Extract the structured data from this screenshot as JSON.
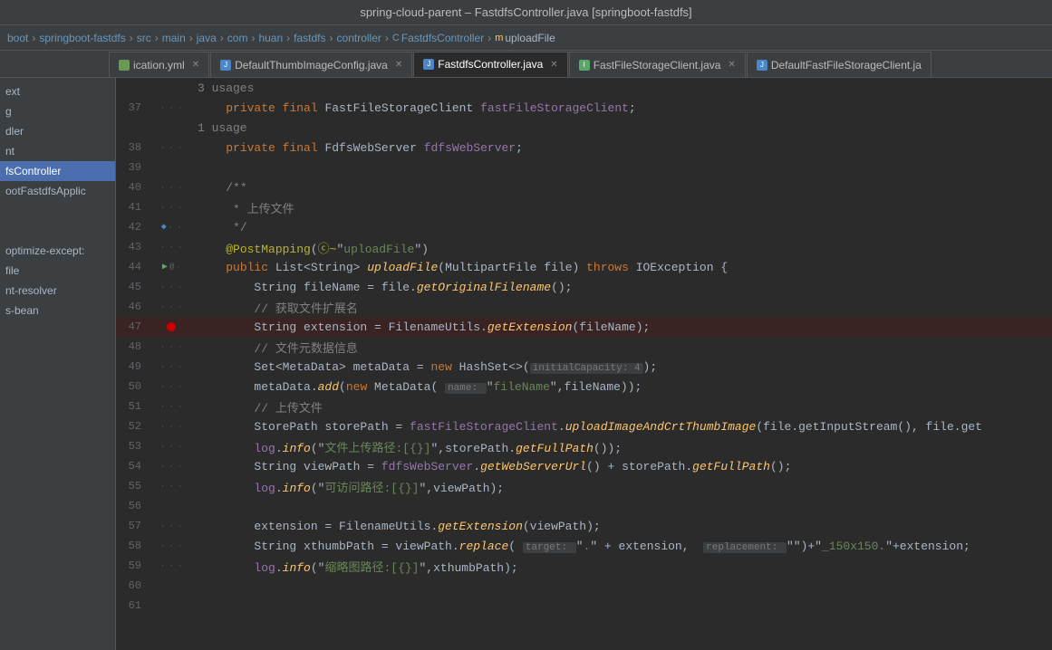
{
  "titleBar": {
    "title": "spring-cloud-parent – FastdfsController.java [springboot-fastdfs]"
  },
  "breadcrumb": {
    "items": [
      "boot",
      "springboot-fastdfs",
      "src",
      "main",
      "java",
      "com",
      "huan",
      "fastdfs",
      "controller"
    ],
    "className": "FastdfsController",
    "methodName": "uploadFile"
  },
  "tabs": [
    {
      "name": "ication.yml",
      "type": "yml",
      "active": false,
      "modified": false
    },
    {
      "name": "DefaultThumbImageConfig.java",
      "type": "java",
      "active": false,
      "modified": false
    },
    {
      "name": "FastdfsController.java",
      "type": "java",
      "active": true,
      "modified": false
    },
    {
      "name": "FastFileStorageClient.java",
      "type": "interface",
      "active": false,
      "modified": false
    },
    {
      "name": "DefaultFastFileStorageClient.ja",
      "type": "java",
      "active": false,
      "modified": false
    }
  ],
  "sidebar": {
    "items": [
      {
        "label": "ext",
        "selected": false
      },
      {
        "label": "g",
        "selected": false
      },
      {
        "label": "dler",
        "selected": false
      },
      {
        "label": "nt",
        "selected": false
      },
      {
        "label": "fsController",
        "selected": true
      },
      {
        "label": "ootFastdfsApplic",
        "selected": false
      },
      {
        "label": "",
        "selected": false
      },
      {
        "label": "",
        "selected": false
      },
      {
        "label": "optimize-except:",
        "selected": false
      },
      {
        "label": "file",
        "selected": false
      },
      {
        "label": "nt-resolver",
        "selected": false
      },
      {
        "label": "s-bean",
        "selected": false
      }
    ]
  },
  "codeLines": [
    {
      "num": 37,
      "usageHint": "3 usages",
      "gutter": "",
      "content": "    <kw>private</kw> <kw>final</kw> FastFileStorageClient <field>fastFileStorageClient</field>;",
      "highlighted": false
    },
    {
      "num": 38,
      "usageHint": "1 usage",
      "gutter": "",
      "content": "    <kw>private</kw> <kw>final</kw> FdfsWebServer <field>fdfsWebServer</field>;",
      "highlighted": false
    },
    {
      "num": 39,
      "gutter": "",
      "content": "",
      "highlighted": false
    },
    {
      "num": 40,
      "gutter": "",
      "content": "    <comment>/**</comment>",
      "highlighted": false
    },
    {
      "num": 41,
      "gutter": "",
      "content": "     <comment>* 上传文件</comment>",
      "highlighted": false
    },
    {
      "num": 42,
      "gutter": "",
      "content": "     <comment>*/</comment>",
      "highlighted": false
    },
    {
      "num": 43,
      "gutter": "",
      "content": "    <annotation>@PostMapping</annotation>(<annotation>@</annotation>\"<str>uploadFile</str>\")",
      "highlighted": false
    },
    {
      "num": 44,
      "gutter": "run annotation",
      "content": "    <kw>public</kw> List<String> <cn>uploadFile</cn>(MultipartFile file) <kw>throws</kw> IOException {",
      "highlighted": false
    },
    {
      "num": 45,
      "gutter": "",
      "content": "        String fileName = file.<cn>getOriginalFilename</cn>();",
      "highlighted": false
    },
    {
      "num": 46,
      "gutter": "",
      "content": "        <comment>// 获取文件扩展名</comment>",
      "highlighted": false
    },
    {
      "num": 47,
      "gutter": "breakpoint",
      "content": "        String extension = FilenameUtils.<cn>getExtension</cn>(fileName);",
      "highlighted": true
    },
    {
      "num": 48,
      "gutter": "",
      "content": "        <comment>// 文件元数据信息</comment>",
      "highlighted": false
    },
    {
      "num": 49,
      "gutter": "",
      "content": "        Set<MetaData> metaData = <kw>new</kw> HashSet<>(<hint>initialCapacity: 4</hint>);",
      "highlighted": false
    },
    {
      "num": 50,
      "gutter": "",
      "content": "        metaData.<cn>add</cn>(<kw>new</kw> MetaData( <hint>name: </hint>\"<str>fileName</str>\",fileName));",
      "highlighted": false
    },
    {
      "num": 51,
      "gutter": "",
      "content": "        <comment>// 上传文件</comment>",
      "highlighted": false
    },
    {
      "num": 52,
      "gutter": "",
      "content": "        StorePath storePath = <field>fastFileStorageClient</field>.<cn>uploadImageAndCrtThumbImage</cn>(file.getInputStream(), file.get",
      "highlighted": false
    },
    {
      "num": 53,
      "gutter": "",
      "content": "        <field>log</field>.<cn>info</cn>(\"<str>文件上传路径:[{}]</str>\",storePath.<cn>getFullPath</cn>());",
      "highlighted": false
    },
    {
      "num": 54,
      "gutter": "",
      "content": "        String viewPath = <field>fdfsWebServer</field>.<cn>getWebServerUrl</cn>() + storePath.<cn>getFullPath</cn>();",
      "highlighted": false
    },
    {
      "num": 55,
      "gutter": "",
      "content": "        <field>log</field>.<cn>info</cn>(\"<str>可访问路径:[{}]</str>\",viewPath);",
      "highlighted": false
    },
    {
      "num": 56,
      "gutter": "",
      "content": "",
      "highlighted": false
    },
    {
      "num": 57,
      "gutter": "",
      "content": "        extension = FilenameUtils.<cn>getExtension</cn>(viewPath);",
      "highlighted": false
    },
    {
      "num": 58,
      "gutter": "",
      "content": "        String xthumbPath = viewPath.<cn>replace</cn>( <hint>target: </hint>\"<str>.</str>\" + extension,  <hint>replacement: </hint>\"<str></str>\")+\"<str>_150x150.</str>\"+extension;",
      "highlighted": false
    },
    {
      "num": 59,
      "gutter": "",
      "content": "        <field>log</field>.<cn>info</cn>(\"<str>缩略图路径:[{}]</str>\",xthumbPath);",
      "highlighted": false
    },
    {
      "num": 60,
      "gutter": "",
      "content": "",
      "highlighted": false
    },
    {
      "num": 61,
      "gutter": "",
      "content": "",
      "highlighted": false
    }
  ]
}
